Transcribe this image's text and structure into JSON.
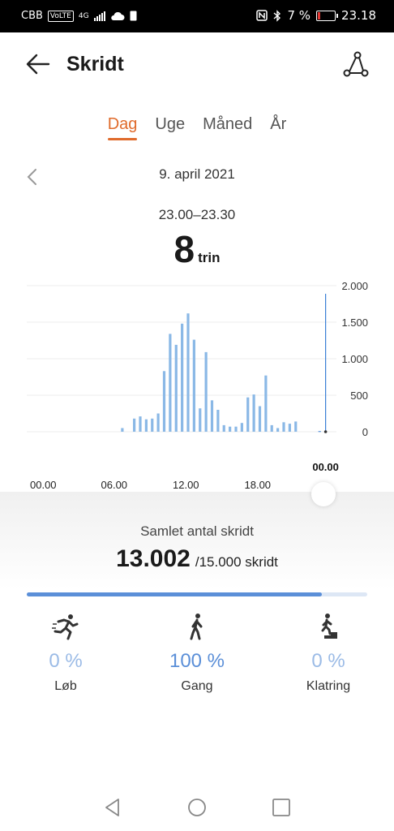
{
  "status_bar": {
    "carrier": "CBB",
    "volte": "VoLTE",
    "net": "4G",
    "battery_pct": "7 %",
    "time": "23.18"
  },
  "header": {
    "title": "Skridt"
  },
  "tabs": [
    {
      "label": "Dag",
      "active": true
    },
    {
      "label": "Uge",
      "active": false
    },
    {
      "label": "Måned",
      "active": false
    },
    {
      "label": "År",
      "active": false
    }
  ],
  "date": "9. april 2021",
  "selected": {
    "range": "23.00–23.30",
    "value": "8",
    "unit": "trin"
  },
  "chart_data": {
    "type": "bar",
    "xlabel": "",
    "ylabel": "",
    "ylim": [
      0,
      2000
    ],
    "y_ticks": [
      "2.000",
      "1.500",
      "1.000",
      "500",
      "0"
    ],
    "x_ticks": [
      "00.00",
      "06.00",
      "12.00",
      "18.00"
    ],
    "selected_tick": "00.00",
    "categories": [
      "06.30",
      "07.30",
      "08.00",
      "08.30",
      "09.00",
      "09.30",
      "10.00",
      "10.30",
      "11.00",
      "11.30",
      "12.00",
      "12.30",
      "13.00",
      "13.30",
      "14.00",
      "14.30",
      "15.00",
      "15.30",
      "16.00",
      "16.30",
      "17.00",
      "17.30",
      "18.00",
      "18.30",
      "19.00",
      "19.30",
      "20.00",
      "20.30",
      "21.00",
      "23.00"
    ],
    "values": [
      50,
      180,
      210,
      170,
      180,
      250,
      830,
      1340,
      1190,
      1480,
      1620,
      1260,
      320,
      1090,
      430,
      300,
      90,
      70,
      70,
      120,
      470,
      510,
      350,
      770,
      90,
      50,
      130,
      110,
      140,
      8
    ],
    "bar_color": "#8ab8e6",
    "selected_color": "#3a7fd5"
  },
  "summary": {
    "label": "Samlet antal skridt",
    "total": "13.002",
    "goal": "/15.000 skridt",
    "progress": 0.867
  },
  "categories": [
    {
      "pct": "0 %",
      "label": "Løb",
      "icon": "running-icon"
    },
    {
      "pct": "100 %",
      "label": "Gang",
      "icon": "walking-icon"
    },
    {
      "pct": "0 %",
      "label": "Klatring",
      "icon": "climbing-icon"
    }
  ]
}
